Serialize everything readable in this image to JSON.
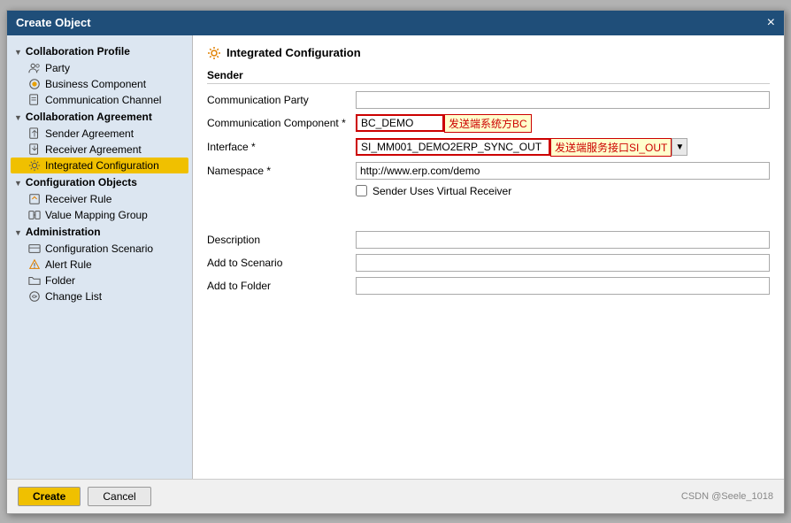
{
  "dialog": {
    "title": "Create Object",
    "close_label": "×"
  },
  "left_panel": {
    "sections": [
      {
        "id": "collaboration-profile",
        "label": "Collaboration Profile",
        "expanded": true,
        "items": [
          {
            "id": "party",
            "label": "Party",
            "selected": false
          },
          {
            "id": "business-component",
            "label": "Business Component",
            "selected": false
          },
          {
            "id": "communication-channel",
            "label": "Communication Channel",
            "selected": false
          }
        ]
      },
      {
        "id": "collaboration-agreement",
        "label": "Collaboration Agreement",
        "expanded": true,
        "items": [
          {
            "id": "sender-agreement",
            "label": "Sender Agreement",
            "selected": false
          },
          {
            "id": "receiver-agreement",
            "label": "Receiver Agreement",
            "selected": false
          },
          {
            "id": "integrated-configuration",
            "label": "Integrated Configuration",
            "selected": true
          }
        ]
      },
      {
        "id": "configuration-objects",
        "label": "Configuration Objects",
        "expanded": true,
        "items": [
          {
            "id": "receiver-rule",
            "label": "Receiver Rule",
            "selected": false
          },
          {
            "id": "value-mapping-group",
            "label": "Value Mapping Group",
            "selected": false
          }
        ]
      },
      {
        "id": "administration",
        "label": "Administration",
        "expanded": true,
        "items": [
          {
            "id": "configuration-scenario",
            "label": "Configuration Scenario",
            "selected": false
          },
          {
            "id": "alert-rule",
            "label": "Alert Rule",
            "selected": false
          },
          {
            "id": "folder",
            "label": "Folder",
            "selected": false
          },
          {
            "id": "change-list",
            "label": "Change List",
            "selected": false
          }
        ]
      }
    ]
  },
  "right_panel": {
    "section_title": "Integrated Configuration",
    "form_group": "Sender",
    "fields": [
      {
        "id": "communication-party",
        "label": "Communication Party",
        "required": false,
        "value": "",
        "type": "text"
      },
      {
        "id": "communication-component",
        "label": "Communication Component",
        "required": true,
        "value": "BC_DEMO",
        "annotation": "发送端系统方BC",
        "type": "annotated"
      },
      {
        "id": "interface",
        "label": "Interface",
        "required": true,
        "value": "SI_MM001_DEMO2ERP_SYNC_OUT",
        "annotation": "发送端服务接口SI_OUT",
        "type": "interface"
      },
      {
        "id": "namespace",
        "label": "Namespace",
        "required": true,
        "value": "http://www.erp.com/demo",
        "type": "text"
      }
    ],
    "checkbox_label": "Sender Uses Virtual Receiver",
    "extra_fields": [
      {
        "id": "description",
        "label": "Description",
        "value": ""
      },
      {
        "id": "add-to-scenario",
        "label": "Add to Scenario",
        "value": ""
      },
      {
        "id": "add-to-folder",
        "label": "Add to Folder",
        "value": ""
      }
    ]
  },
  "footer": {
    "create_label": "Create",
    "cancel_label": "Cancel",
    "watermark": "CSDN @Seele_1018"
  }
}
